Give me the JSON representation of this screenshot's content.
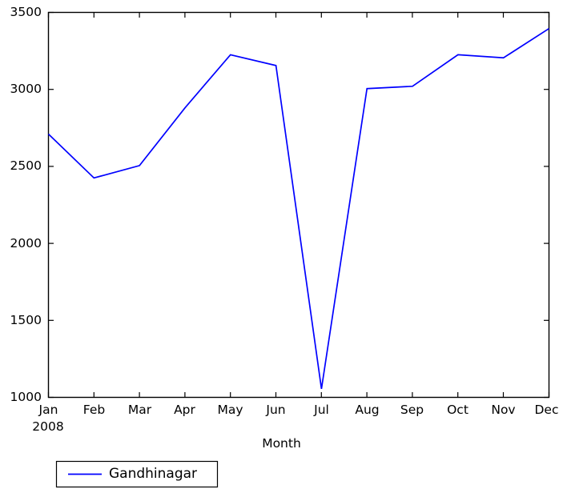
{
  "chart_data": {
    "type": "line",
    "title": "",
    "xlabel": "Month",
    "ylabel": "",
    "categories": [
      "Jan",
      "Feb",
      "Mar",
      "Apr",
      "May",
      "Jun",
      "Jul",
      "Aug",
      "Sep",
      "Oct",
      "Nov",
      "Dec"
    ],
    "x_axis_sublabel": "2008",
    "series": [
      {
        "name": "Gandhinagar",
        "color": "#0000ff",
        "values": [
          2710,
          2425,
          2505,
          2880,
          3225,
          3155,
          1055,
          3005,
          3020,
          3225,
          3205,
          3395
        ]
      }
    ],
    "xlim": [
      0,
      11
    ],
    "ylim": [
      1000,
      3500
    ],
    "y_ticks": [
      1000,
      1500,
      2000,
      2500,
      3000,
      3500
    ],
    "y_tick_labels": [
      "1000",
      "1500",
      "2000",
      "2500",
      "3000",
      "3500"
    ],
    "x_ticks": [
      "Jan",
      "Feb",
      "Mar",
      "Apr",
      "May",
      "Jun",
      "Jul",
      "Aug",
      "Sep",
      "Oct",
      "Nov",
      "Dec"
    ],
    "grid": false,
    "legend_position": "below-left",
    "legend_entries": [
      "Gandhinagar"
    ],
    "axis_color": "#000000",
    "background_color": "#ffffff"
  },
  "axis": {
    "y_labels": [
      "3500",
      "3000",
      "2500",
      "2000",
      "1500",
      "1000"
    ],
    "x_labels": [
      "Jan",
      "Feb",
      "Mar",
      "Apr",
      "May",
      "Jun",
      "Jul",
      "Aug",
      "Sep",
      "Oct",
      "Nov",
      "Dec"
    ],
    "x_sub": "2008",
    "x_title": "Month"
  },
  "legend": {
    "label_0": "Gandhinagar"
  }
}
